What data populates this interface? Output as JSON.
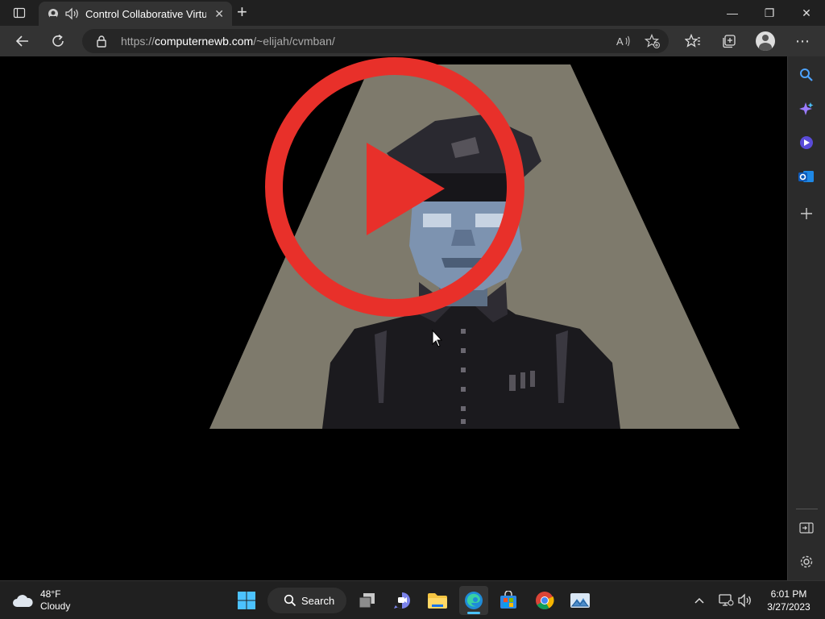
{
  "browser": {
    "tab": {
      "title": "Control Collaborative Virtua",
      "close_glyph": "✕"
    },
    "new_tab_glyph": "+",
    "window_controls": {
      "minimize": "—",
      "restore": "❐",
      "close": "✕"
    },
    "address": {
      "url_prefix": "https://",
      "url_host": "computernewb.com",
      "url_path": "/~elijah/cvmban/"
    },
    "more_glyph": "⋯"
  },
  "page": {
    "video": {
      "play_button": "play-icon"
    }
  },
  "sidebar": {
    "items": [
      {
        "name": "search-icon"
      },
      {
        "name": "copilot-icon"
      },
      {
        "name": "games-icon"
      },
      {
        "name": "outlook-icon"
      },
      {
        "name": "add-icon"
      },
      {
        "name": "sidebar-toggle-icon"
      },
      {
        "name": "settings-icon"
      }
    ]
  },
  "taskbar": {
    "weather": {
      "temp": "48°F",
      "condition": "Cloudy"
    },
    "search_label": "Search",
    "clock": {
      "time": "6:01 PM",
      "date": "3/27/2023"
    }
  },
  "colors": {
    "play_red": "#e8302a",
    "spotlight": "#7e7a6c",
    "accent": "#4cc2ff"
  }
}
